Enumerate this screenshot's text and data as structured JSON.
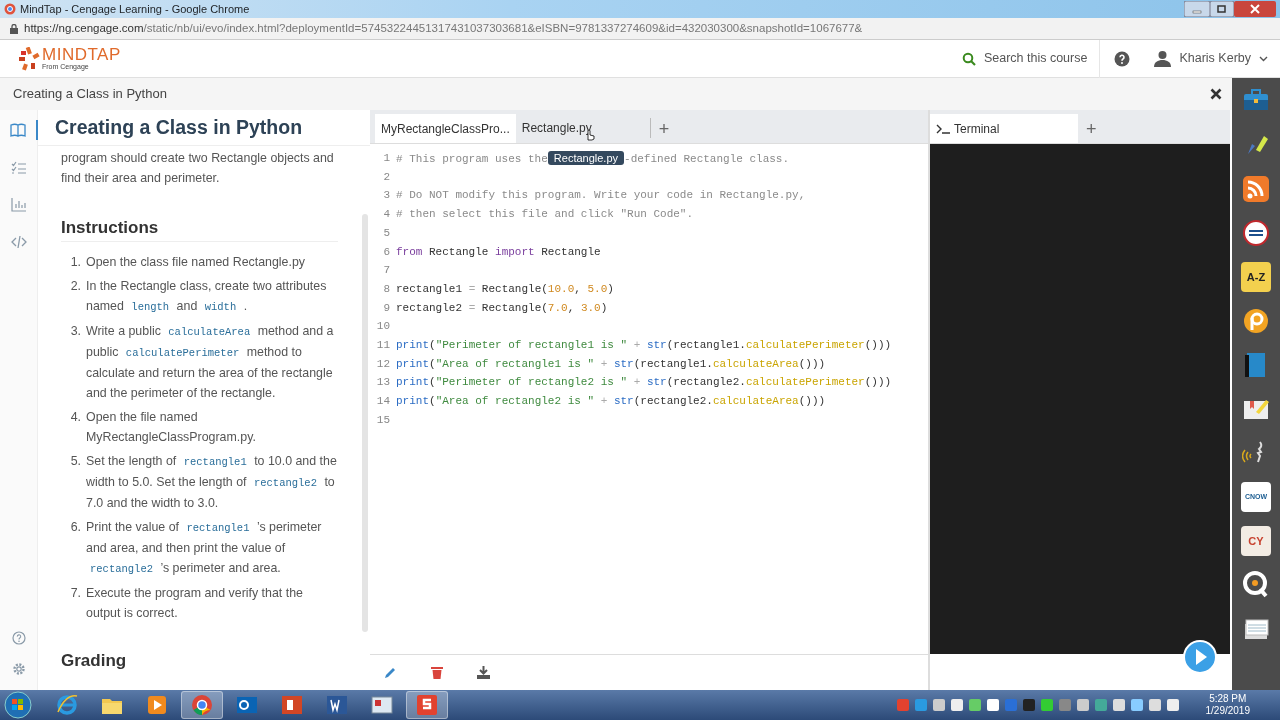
{
  "window": {
    "title": "MindTap - Cengage Learning - Google Chrome"
  },
  "address_bar": {
    "host": "https://ng.cengage.com",
    "path": "/static/nb/ui/evo/index.html?deploymentId=57453224451317431037303681&eISBN=9781337274609&id=432030300&snapshotId=1067677&"
  },
  "header": {
    "brand": "MINDTAP",
    "brand_sub": "From Cengage",
    "search_label": "Search this course",
    "user": "Kharis Kerby"
  },
  "breadcrumb": "Creating a Class in Python",
  "rail": [
    {
      "kind": "book",
      "selected": true
    },
    {
      "kind": "checklist",
      "selected": false
    },
    {
      "kind": "chart",
      "selected": false
    },
    {
      "kind": "code",
      "selected": false
    }
  ],
  "panel": {
    "title": "Creating a Class in Python",
    "intro": "program should create two Rectangle objects and find their area and perimeter.",
    "instructions_heading": "Instructions",
    "instructions": [
      [
        {
          "kind": "text",
          "text": "Open the class file named Rectangle.py"
        }
      ],
      [
        {
          "kind": "text",
          "text": "In the Rectangle class, create two attributes named "
        },
        {
          "kind": "code",
          "text": "length"
        },
        {
          "kind": "text",
          "text": " and "
        },
        {
          "kind": "code",
          "text": "width"
        },
        {
          "kind": "text",
          "text": " ."
        }
      ],
      [
        {
          "kind": "text",
          "text": "Write a public "
        },
        {
          "kind": "code",
          "text": "calculateArea"
        },
        {
          "kind": "text",
          "text": " method and a public "
        },
        {
          "kind": "code",
          "text": "calculatePerimeter"
        },
        {
          "kind": "text",
          "text": " method to calculate and return the area of the rectangle and the perimeter of the rectangle."
        }
      ],
      [
        {
          "kind": "text",
          "text": "Open the file named MyRectangleClassProgram.py."
        }
      ],
      [
        {
          "kind": "text",
          "text": "Set the length of "
        },
        {
          "kind": "code",
          "text": "rectangle1"
        },
        {
          "kind": "text",
          "text": " to 10.0 and the width to 5.0. Set the length of "
        },
        {
          "kind": "code",
          "text": "rectangle2"
        },
        {
          "kind": "text",
          "text": " to 7.0 and the width to 3.0."
        }
      ],
      [
        {
          "kind": "text",
          "text": "Print the value of "
        },
        {
          "kind": "code",
          "text": "rectangle1"
        },
        {
          "kind": "text",
          "text": " ’s perimeter and area, and then print the value of "
        },
        {
          "kind": "code",
          "text": "rectangle2"
        },
        {
          "kind": "text",
          "text": " ’s perimeter and area."
        }
      ],
      [
        {
          "kind": "text",
          "text": "Execute the program and verify that the output is correct."
        }
      ]
    ],
    "numbers": [
      "1.",
      "2.",
      "3.",
      "4.",
      "5.",
      "6.",
      "7."
    ],
    "grading_heading": "Grading"
  },
  "editor": {
    "tabs": [
      {
        "label": "MyRectangleClassPro...",
        "selected": true
      },
      {
        "label": "Rectangle.py",
        "selected": false
      }
    ],
    "add_tab": "+",
    "lines": [
      {
        "num": "1",
        "tokens": [
          {
            "kind": "comment",
            "text": "# This program uses the"
          },
          {
            "kind": "tooltip",
            "text": "Rectangle.py"
          },
          {
            "kind": "comment",
            "text": "-defined Rectangle class."
          }
        ]
      },
      {
        "num": "2"
      },
      {
        "num": "3",
        "tokens": [
          {
            "kind": "comment",
            "text": "# Do NOT modify this program. Write your code in Rectangle.py,"
          }
        ]
      },
      {
        "num": "4",
        "tokens": [
          {
            "kind": "comment",
            "text": "# then select this file and click \"Run Code\"."
          }
        ]
      },
      {
        "num": "5"
      },
      {
        "num": "6",
        "tokens": [
          {
            "kind": "kw",
            "text": "from"
          },
          {
            "kind": "plain",
            "text": " Rectangle "
          },
          {
            "kind": "kw",
            "text": "import"
          },
          {
            "kind": "plain",
            "text": " Rectangle"
          }
        ]
      },
      {
        "num": "7"
      },
      {
        "num": "8",
        "tokens": [
          {
            "kind": "plain",
            "text": "rectangle1 "
          },
          {
            "kind": "op",
            "text": "="
          },
          {
            "kind": "plain",
            "text": " Rectangle("
          },
          {
            "kind": "num",
            "text": "10.0"
          },
          {
            "kind": "plain",
            "text": ", "
          },
          {
            "kind": "num",
            "text": "5.0"
          },
          {
            "kind": "plain",
            "text": ")"
          }
        ]
      },
      {
        "num": "9",
        "tokens": [
          {
            "kind": "plain",
            "text": "rectangle2 "
          },
          {
            "kind": "op",
            "text": "="
          },
          {
            "kind": "plain",
            "text": " Rectangle("
          },
          {
            "kind": "num",
            "text": "7.0"
          },
          {
            "kind": "plain",
            "text": ", "
          },
          {
            "kind": "num",
            "text": "3.0"
          },
          {
            "kind": "plain",
            "text": ")"
          }
        ]
      },
      {
        "num": "10"
      },
      {
        "num": "11",
        "tokens": [
          {
            "kind": "builtin",
            "text": "print"
          },
          {
            "kind": "plain",
            "text": "("
          },
          {
            "kind": "str",
            "text": "\"Perimeter of rectangle1 is \""
          },
          {
            "kind": "op",
            "text": " + "
          },
          {
            "kind": "builtin",
            "text": "str"
          },
          {
            "kind": "plain",
            "text": "(rectangle1."
          },
          {
            "kind": "method",
            "text": "calculatePerimeter"
          },
          {
            "kind": "plain",
            "text": "()))"
          }
        ]
      },
      {
        "num": "12",
        "tokens": [
          {
            "kind": "builtin",
            "text": "print"
          },
          {
            "kind": "plain",
            "text": "("
          },
          {
            "kind": "str",
            "text": "\"Area of rectangle1 is \""
          },
          {
            "kind": "op",
            "text": " + "
          },
          {
            "kind": "builtin",
            "text": "str"
          },
          {
            "kind": "plain",
            "text": "(rectangle1."
          },
          {
            "kind": "method",
            "text": "calculateArea"
          },
          {
            "kind": "plain",
            "text": "()))"
          }
        ]
      },
      {
        "num": "13",
        "tokens": [
          {
            "kind": "builtin",
            "text": "print"
          },
          {
            "kind": "plain",
            "text": "("
          },
          {
            "kind": "str",
            "text": "\"Perimeter of rectangle2 is \""
          },
          {
            "kind": "op",
            "text": " + "
          },
          {
            "kind": "builtin",
            "text": "str"
          },
          {
            "kind": "plain",
            "text": "(rectangle2."
          },
          {
            "kind": "method",
            "text": "calculatePerimeter"
          },
          {
            "kind": "plain",
            "text": "()))"
          }
        ]
      },
      {
        "num": "14",
        "tokens": [
          {
            "kind": "builtin",
            "text": "print"
          },
          {
            "kind": "plain",
            "text": "("
          },
          {
            "kind": "str",
            "text": "\"Area of rectangle2 is \""
          },
          {
            "kind": "op",
            "text": " + "
          },
          {
            "kind": "builtin",
            "text": "str"
          },
          {
            "kind": "plain",
            "text": "(rectangle2."
          },
          {
            "kind": "method",
            "text": "calculateArea"
          },
          {
            "kind": "plain",
            "text": "()))"
          }
        ]
      },
      {
        "num": "15"
      }
    ]
  },
  "terminal": {
    "tabs": [
      {
        "label": "Terminal",
        "selected": true
      }
    ],
    "add_tab": "+"
  },
  "tools": [
    {
      "kind": "briefcase"
    },
    {
      "kind": "highlighter"
    },
    {
      "kind": "rss"
    },
    {
      "kind": "dictionary"
    },
    {
      "kind": "tile",
      "label": "A-Z"
    },
    {
      "kind": "orange-circle"
    },
    {
      "kind": "book"
    },
    {
      "kind": "note"
    },
    {
      "kind": "speech"
    },
    {
      "kind": "tile-white",
      "label": "CNOW"
    },
    {
      "kind": "tile-diamond",
      "label": "CY"
    },
    {
      "kind": "quiz"
    },
    {
      "kind": "cards"
    }
  ],
  "taskbar": {
    "apps": [
      {
        "kind": "ie",
        "selected": false
      },
      {
        "kind": "folder",
        "selected": false
      },
      {
        "kind": "media",
        "selected": false
      },
      {
        "kind": "chrome",
        "selected": true
      },
      {
        "kind": "outlook",
        "selected": false
      },
      {
        "kind": "powerpoint",
        "selected": false
      },
      {
        "kind": "word",
        "selected": false
      },
      {
        "kind": "reader",
        "selected": false
      },
      {
        "kind": "snagit",
        "selected": true
      }
    ],
    "time": "5:28 PM",
    "date": "1/29/2019"
  }
}
